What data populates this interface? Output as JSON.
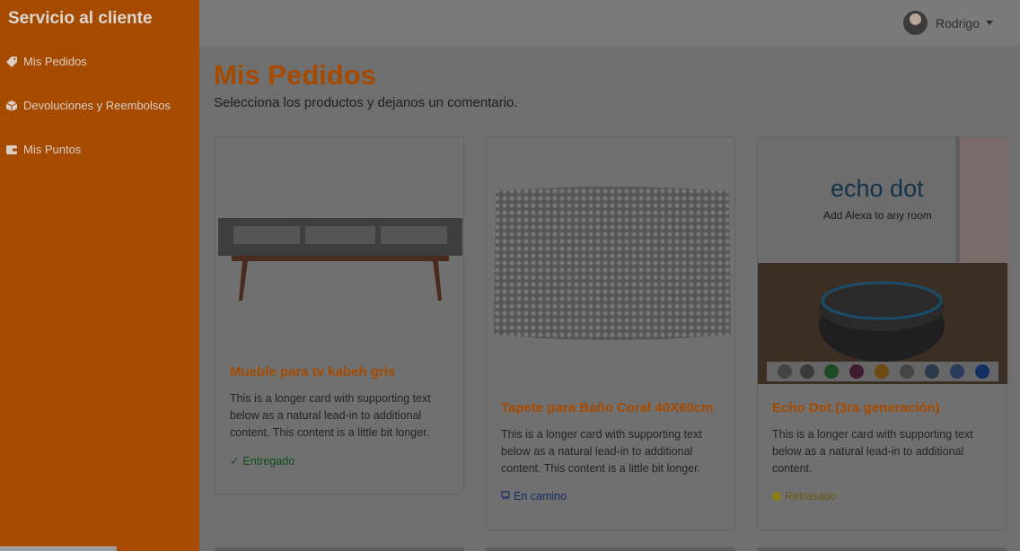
{
  "sidebar": {
    "brand": "Servicio al cliente",
    "items": [
      {
        "label": "Mis Pedidos",
        "icon": "tag-icon"
      },
      {
        "label": "Devoluciones y Reembolsos",
        "icon": "box-icon"
      },
      {
        "label": "Mis Puntos",
        "icon": "wallet-icon"
      }
    ]
  },
  "topbar": {
    "user_name": "Rodrigo"
  },
  "main": {
    "title": "Mis Pedidos",
    "subtitle": "Selecciona los productos y dejanos un comentario.",
    "cards": [
      {
        "title": "Mueble para tv kabeh gris",
        "text": "This is a longer card with supporting text below as a natural lead-in to additional content. This content is a little bit longer.",
        "status": "Entregado",
        "status_icon": "check-icon"
      },
      {
        "title": "Tapete para Baño Coral 40X60cm",
        "text": "This is a longer card with supporting text below as a natural lead-in to additional content. This content is a little bit longer.",
        "status": "En camino",
        "status_icon": "truck-icon"
      },
      {
        "title": "Echo Dot (3ra generación)",
        "text": "This is a longer card with supporting text below as a natural lead-in to additional content.",
        "status": "Retrasado",
        "status_icon": "yellow-dot-icon",
        "image_text_1": "echo dot",
        "image_text_2": "Add Alexa to any room"
      }
    ]
  },
  "colors": {
    "accent": "#a64a00",
    "sidebar_bg": "#a64a00",
    "delivered": "#0d4d1a",
    "on_the_way": "#1a2a66",
    "delayed": "#8c7a12"
  }
}
